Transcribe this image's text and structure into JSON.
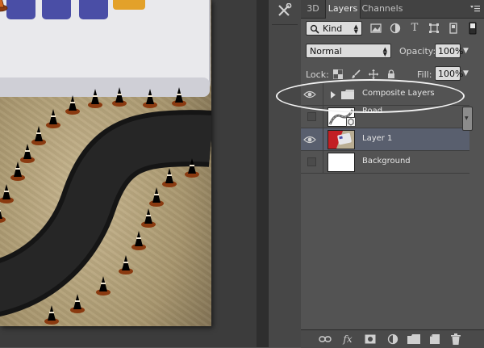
{
  "tool_strip": {
    "tool_icon": "tools-icon"
  },
  "panel": {
    "tabs": [
      {
        "label": "3D"
      },
      {
        "label": "Layers"
      },
      {
        "label": "Channels"
      }
    ],
    "active_tab": "Layers",
    "filter": {
      "kind_label": "Kind"
    },
    "blend_mode": "Normal",
    "opacity_label": "Opacity:",
    "opacity_value": "100%",
    "lock_label": "Lock:",
    "fill_label": "Fill:",
    "fill_value": "100%",
    "layers": [
      {
        "name": "Composite Layers",
        "visible": true,
        "type": "group"
      },
      {
        "name": "Road",
        "visible": false,
        "type": "smart-object"
      },
      {
        "name": "Layer 1",
        "visible": true,
        "type": "image",
        "selected": true
      },
      {
        "name": "Background",
        "visible": false,
        "type": "fill"
      }
    ],
    "footer_fx_label": "fx"
  },
  "colors": {
    "panel_bg": "#535353",
    "selected_row": "#595f6e",
    "callout": "#f3f3f3",
    "cone": "#d0641f"
  }
}
